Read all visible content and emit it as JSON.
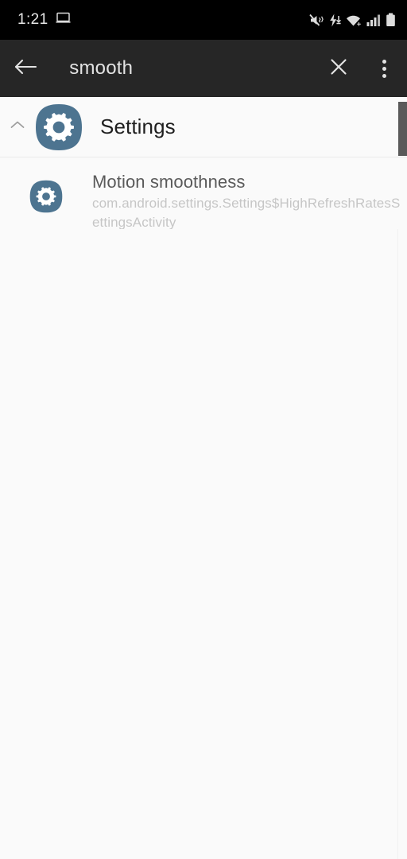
{
  "status_bar": {
    "time": "1:21",
    "left_icons": [
      "laptop-icon"
    ],
    "right_icons": [
      "ringer-vibrate-muted-icon",
      "battery-charging-bolt-icon",
      "wifi-icon",
      "cellular-signal-icon",
      "battery-icon"
    ],
    "background": "#000000",
    "text_color": "#e8e8e8"
  },
  "toolbar": {
    "back_label": "back-arrow",
    "query": "smooth",
    "query_placeholder": "Search",
    "clear_label": "clear",
    "overflow_label": "More options",
    "background": "#262626",
    "icon_color": "#e3e3e3"
  },
  "results": {
    "app_group": {
      "name": "Settings",
      "icon": "settings-gear-icon",
      "expanded": true,
      "collapse_icon": "chevron-up-icon",
      "icon_bg": "#4d7490",
      "icon_fg": "#ffffff"
    },
    "items": [
      {
        "title": "Motion smoothness",
        "subtitle": "com.android.settings.Settings$HighRefreshRatesSettingsActivity",
        "icon": "settings-gear-icon"
      }
    ]
  },
  "scrollbar": {
    "thumb_color": "#5a5a5a",
    "position": "top"
  },
  "page": {
    "background": "#fafafa",
    "divider_color": "#ebebeb"
  }
}
